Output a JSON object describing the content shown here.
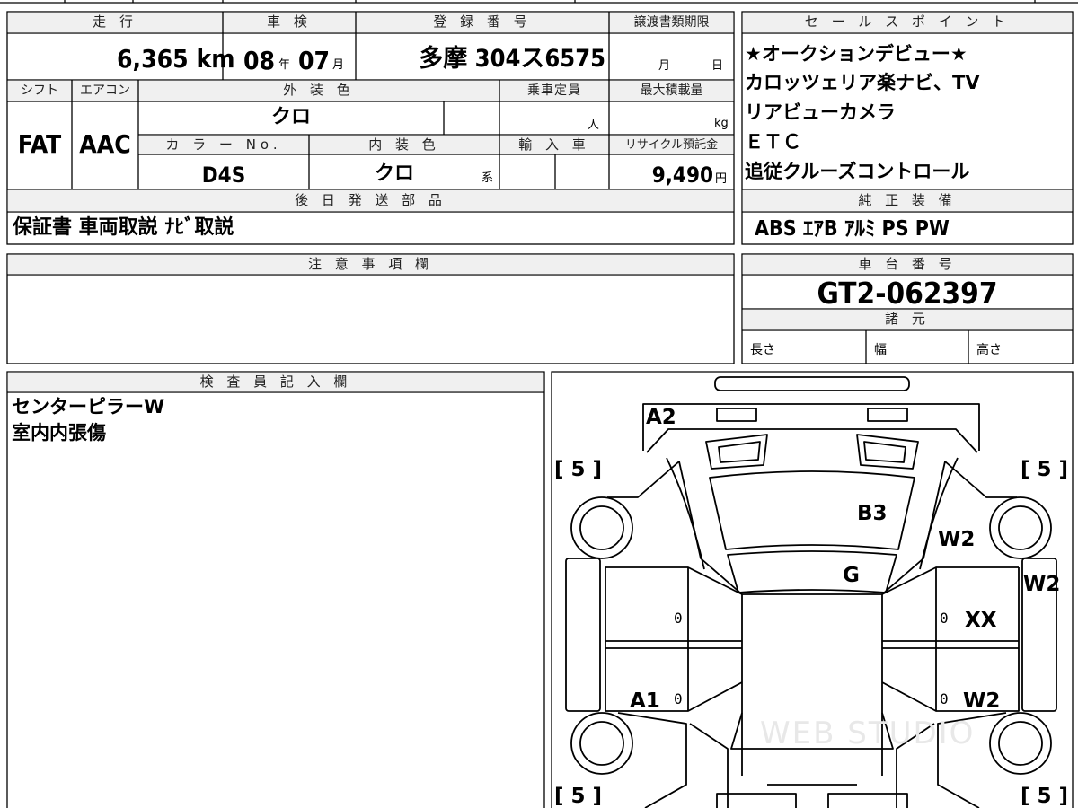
{
  "headers": {
    "mileage": "走 行",
    "inspection": "車 検",
    "registration": "登 録 番 号",
    "transfer_deadline": "譲渡書類期限",
    "sales_points": "セ ー ル ス ポ イ ン ト",
    "shift": "シフト",
    "aircon": "エアコン",
    "exterior_color": "外 装 色",
    "capacity": "乗車定員",
    "max_load": "最大積載量",
    "color_no": "カ ラ ー No.",
    "interior_color": "内 装 色",
    "import": "輸 入 車",
    "recycle": "リサイクル預託金",
    "post_shipping": "後 日 発 送 部 品",
    "standard_equipment": "純 正 装 備",
    "notes": "注 意 事 項 欄",
    "chassis_no": "車 台 番 号",
    "specs": "諸 元",
    "inspector": "検 査 員 記 入 欄"
  },
  "vehicle": {
    "mileage_value": "6,365",
    "mileage_unit": "km",
    "inspection_year": "08",
    "year_unit": "年",
    "inspection_month": "07",
    "month_unit": "月",
    "registration_number": "多摩 304ス6575",
    "deadline_month_unit": "月",
    "deadline_day_unit": "日",
    "shift": "FAT",
    "aircon": "AAC",
    "exterior_color": "クロ",
    "capacity_unit": "人",
    "load_unit": "kg",
    "color_no": "D4S",
    "interior_color": "クロ",
    "interior_suffix": "系",
    "recycle_value": "9,490",
    "recycle_unit": "円",
    "chassis_number": "GT2-062397"
  },
  "sales_points": [
    "★オークションデビュー★",
    "カロッツェリア楽ナビ、TV",
    "リアビューカメラ",
    "ＥＴＣ",
    "追従クルーズコントロール"
  ],
  "post_shipping_parts": "保証書 車両取説 ﾅﾋﾞ取説",
  "standard_equipment": "ABS ｴｱB ｱﾙﾐ PS PW",
  "specs": {
    "length": "長さ",
    "width": "幅",
    "height": "高さ"
  },
  "inspector_notes": [
    "センターピラーW",
    "室内内張傷"
  ],
  "damage_marks": {
    "A2": "A2",
    "B3": "B3",
    "G": "G",
    "W2_right_upper": "W2",
    "W2_right_side": "W2",
    "XX": "XX",
    "A1": "A1",
    "W2_right_lower": "W2",
    "tire_fl": "[ 5 ]",
    "tire_fr": "[ 5 ]",
    "tire_rl": "[ 5 ]",
    "tire_rr": "[ 5 ]",
    "zero": "0"
  },
  "watermark": "WEB STUDIO"
}
